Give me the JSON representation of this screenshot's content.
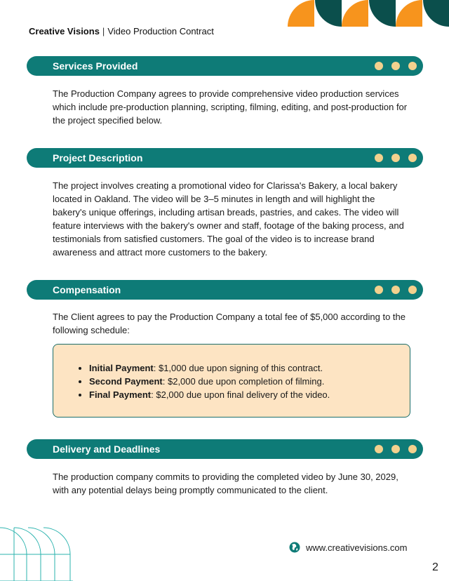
{
  "header": {
    "brand": "Creative Visions",
    "separator": "|",
    "doc_title": "Video Production Contract"
  },
  "colors": {
    "teal": "#0e7b77",
    "dark_teal": "#0b4f4c",
    "orange": "#f7941d",
    "dot": "#f3d18e",
    "callout_bg": "#fde4c3"
  },
  "sections": [
    {
      "title": "Services Provided",
      "body": "The Production Company agrees to provide comprehensive video production services which include pre-production planning, scripting, filming, editing, and post-production for the project specified below."
    },
    {
      "title": "Project Description",
      "body": "The project involves creating a promotional video for Clarissa's Bakery, a local bakery located in Oakland. The video will be 3–5 minutes in length and will highlight the bakery's unique offerings, including artisan breads, pastries, and cakes. The video will feature interviews with the bakery's owner and staff, footage of the baking process, and testimonials from satisfied customers. The goal of the video is to increase brand awareness and attract more customers to the bakery."
    },
    {
      "title": "Compensation",
      "body": "The Client agrees to pay the Production Company a total fee of $5,000 according to the following schedule:",
      "payments": [
        {
          "label": "Initial Payment",
          "text": ": $1,000 due upon signing of this contract."
        },
        {
          "label": "Second Payment",
          "text": ": $2,000 due upon completion of filming."
        },
        {
          "label": "Final Payment",
          "text": ": $2,000 due upon final delivery of the video."
        }
      ]
    },
    {
      "title": "Delivery and Deadlines",
      "body": "The production company commits to providing the completed video by June 30, 2029, with any potential delays being promptly communicated to the client."
    }
  ],
  "footer": {
    "website_icon": "globe-icon",
    "website": "www.creativevisions.com",
    "page_number": "2"
  }
}
